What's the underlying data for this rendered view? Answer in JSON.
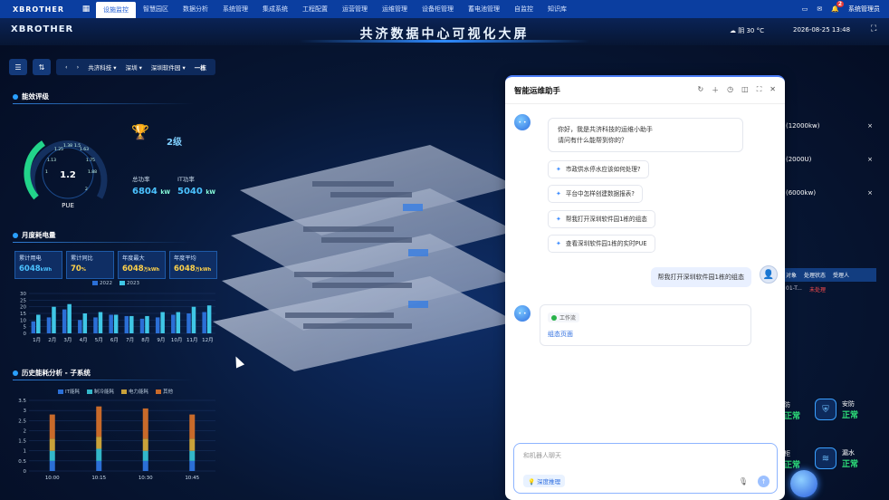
{
  "topnav": {
    "logo": "XBROTHER",
    "items": [
      "设施监控",
      "智慧园区",
      "数据分析",
      "系统管理",
      "集成系统",
      "工程配置",
      "运营管理",
      "运维管理",
      "设备柜管理",
      "蓄电池管理",
      "自监控",
      "知识库"
    ],
    "active_index": 0,
    "notification_count": "2",
    "user": "系统管理员"
  },
  "header": {
    "logo": "XBROTHER",
    "title": "共济数据中心可视化大屏",
    "weather": "阴 30 °C",
    "datetime": "2026-08-25 13:48"
  },
  "toolbar": {
    "crumbs": [
      "共济科技",
      "深圳",
      "深圳软件园",
      "一栋"
    ]
  },
  "efficiency": {
    "section_title": "能效评级",
    "pue_value": "1.2",
    "pue_label": "PUE",
    "gauge_ticks": [
      "1.25",
      "1.38",
      "1.5",
      "1.63",
      "1.75",
      "1.88",
      "1.13",
      "1",
      "2"
    ],
    "grade": "2级",
    "total_power_label": "总功率",
    "total_power_value": "6804",
    "total_power_unit": "kW",
    "it_power_label": "IT功率",
    "it_power_value": "5040",
    "it_power_unit": "kW"
  },
  "monthly": {
    "section_title": "月度耗电量",
    "cards": [
      {
        "label": "累计用电",
        "value": "6048",
        "unit": "kWh"
      },
      {
        "label": "累计同比",
        "value": "70",
        "unit": "%"
      },
      {
        "label": "年度最大",
        "value": "6048",
        "unit": "万kWh"
      },
      {
        "label": "年度平均",
        "value": "6048",
        "unit": "万kWh"
      }
    ],
    "legend": [
      "2022",
      "2023"
    ]
  },
  "history": {
    "section_title": "历史能耗分析 - 子系统",
    "legend": [
      "IT能耗",
      "制冷能耗",
      "电力能耗",
      "其他"
    ]
  },
  "right": {
    "rows": [
      "(12000kw)",
      "(2000U)",
      "(6000kw)"
    ],
    "table_headers": [
      "对象",
      "处理状态",
      "受理人"
    ],
    "table_row": [
      "01-T...",
      "未处理",
      ""
    ],
    "statuses": [
      {
        "label": "防",
        "value": "正常"
      },
      {
        "label": "安防",
        "value": "正常"
      },
      {
        "label": "柜",
        "value": "正常"
      },
      {
        "label": "漏水",
        "value": "正常"
      }
    ]
  },
  "chat": {
    "title": "智能运维助手",
    "greeting_line1": "你好，我是共济科技的运维小助手",
    "greeting_line2": "请问有什么能帮到你的？",
    "suggestions": [
      "市政供水停水应该如何处理?",
      "平台中怎样创建数据报表?",
      "帮我打开深圳软件园1栋的组态",
      "查看深圳软件园1栋的实时PUE"
    ],
    "user_message": "帮我打开深圳软件园1栋的组态",
    "workflow_tag": "工作流",
    "workflow_link": "组态页面",
    "input_placeholder": "和机器人聊天",
    "deep_think": "深度推理"
  },
  "chart_data": [
    {
      "type": "bar",
      "title": "月度耗电量",
      "categories": [
        "1月",
        "2月",
        "3月",
        "4月",
        "5月",
        "6月",
        "7月",
        "8月",
        "9月",
        "10月",
        "11月",
        "12月"
      ],
      "ylim": [
        0,
        30
      ],
      "yticks": [
        0,
        5,
        10,
        15,
        20,
        25,
        30
      ],
      "series": [
        {
          "name": "2022",
          "values": [
            9,
            12,
            18,
            10,
            12,
            14,
            13,
            11,
            12,
            14,
            15,
            16
          ]
        },
        {
          "name": "2023",
          "values": [
            14,
            20,
            22,
            15,
            16,
            14,
            13,
            13,
            16,
            16,
            20,
            21
          ]
        }
      ]
    },
    {
      "type": "bar",
      "title": "历史能耗分析 - 子系统",
      "categories": [
        "10:00",
        "10:15",
        "10:30",
        "10:45"
      ],
      "ylim": [
        0,
        3.5
      ],
      "yticks": [
        0,
        0.5,
        1,
        1.5,
        2,
        2.5,
        3,
        3.5
      ],
      "series": [
        {
          "name": "IT能耗",
          "values": [
            0.5,
            0.5,
            0.5,
            0.5
          ]
        },
        {
          "name": "制冷能耗",
          "values": [
            0.5,
            0.6,
            0.5,
            0.5
          ]
        },
        {
          "name": "电力能耗",
          "values": [
            0.6,
            0.6,
            0.6,
            0.6
          ]
        },
        {
          "name": "其他",
          "values": [
            1.2,
            1.5,
            1.5,
            1.2
          ]
        }
      ]
    }
  ]
}
